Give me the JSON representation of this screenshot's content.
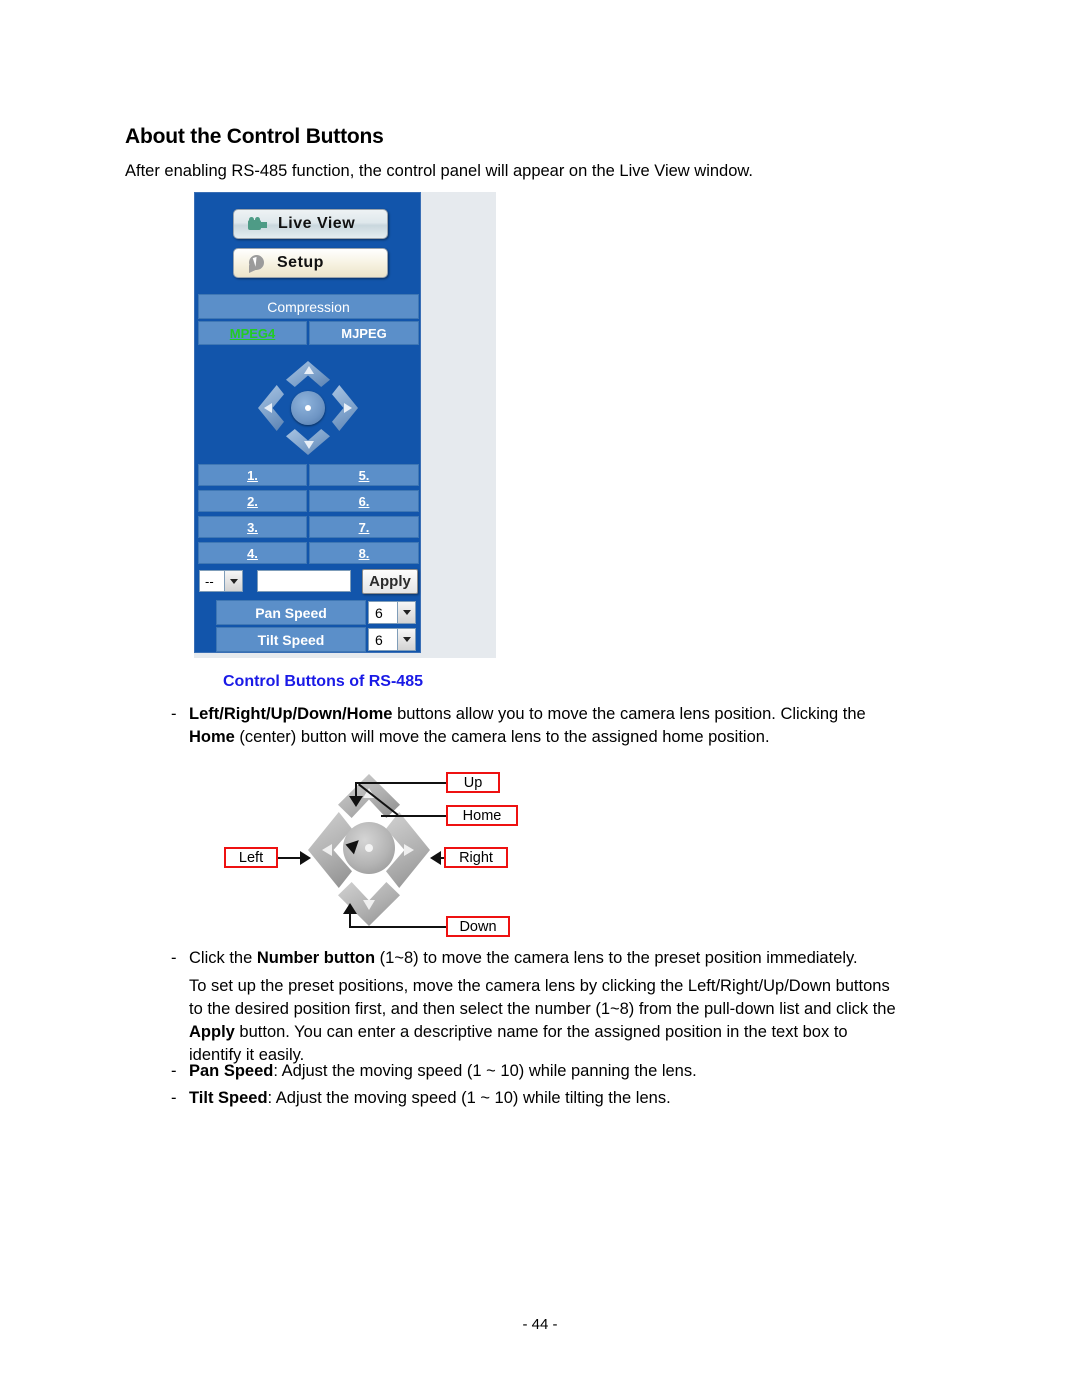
{
  "document": {
    "heading": "About the Control Buttons",
    "intro": "After enabling RS-485 function, the control panel will appear on the Live View window.",
    "figure_caption": "Control Buttons of RS-485",
    "page_number": "- 44 -",
    "caption_color": "#1a1ae6"
  },
  "control_panel": {
    "live_view_button": "Live View",
    "setup_button": "Setup",
    "compression_title": "Compression",
    "compression_tabs": [
      {
        "label": "MPEG4",
        "state": "active-link",
        "color": "#22cc22"
      },
      {
        "label": "MJPEG",
        "state": "inactive",
        "color": "#ffffff"
      }
    ],
    "dpad": {
      "up": "Up",
      "down": "Down",
      "left": "Left",
      "right": "Right",
      "home": "Home"
    },
    "presets": {
      "left_column": [
        "1.",
        "2.",
        "3.",
        "4."
      ],
      "right_column": [
        "5.",
        "6.",
        "7.",
        "8."
      ]
    },
    "preset_select_value": "--",
    "preset_name_value": "",
    "preset_name_placeholder": "",
    "apply_button": "Apply",
    "speeds": [
      {
        "label": "Pan Speed",
        "value": "6"
      },
      {
        "label": "Tilt Speed",
        "value": "6"
      }
    ],
    "panel_color": "#1255ab",
    "row_color": "#5b8fc9"
  },
  "diagram": {
    "labels": {
      "up": "Up",
      "home": "Home",
      "right": "Right",
      "down": "Down",
      "left": "Left"
    },
    "label_border_color": "#ee1111"
  },
  "bullets": {
    "b1_line1_bold": "Left/Right/Up/Down/Home",
    "b1_line1_rest": " buttons allow you to move the camera lens position. Clicking the",
    "b1_line2_bold": "Home",
    "b1_line2_rest": " (center) button will move the camera lens to the assigned home position.",
    "b2_pre": "Click the ",
    "b2_bold": "Number button",
    "b2_post": " (1~8) to move the camera lens to the preset position immediately.",
    "b2_para_1": "To set up the preset positions, move the camera lens by clicking the Left/Right/Up/Down buttons",
    "b2_para_2": "to the desired position first, and then select the number (1~8) from the pull-down list and click the",
    "b2_para_3_bold": "Apply",
    "b2_para_3_rest": " button. You can enter a descriptive name for the assigned position in the text box to",
    "b2_para_4": "identify it easily.",
    "b3_bold": "Pan Speed",
    "b3_rest": ": Adjust the moving speed (1 ~ 10) while panning the lens.",
    "b4_bold": "Tilt Speed",
    "b4_rest": ": Adjust the moving speed (1 ~ 10) while tilting the lens."
  }
}
